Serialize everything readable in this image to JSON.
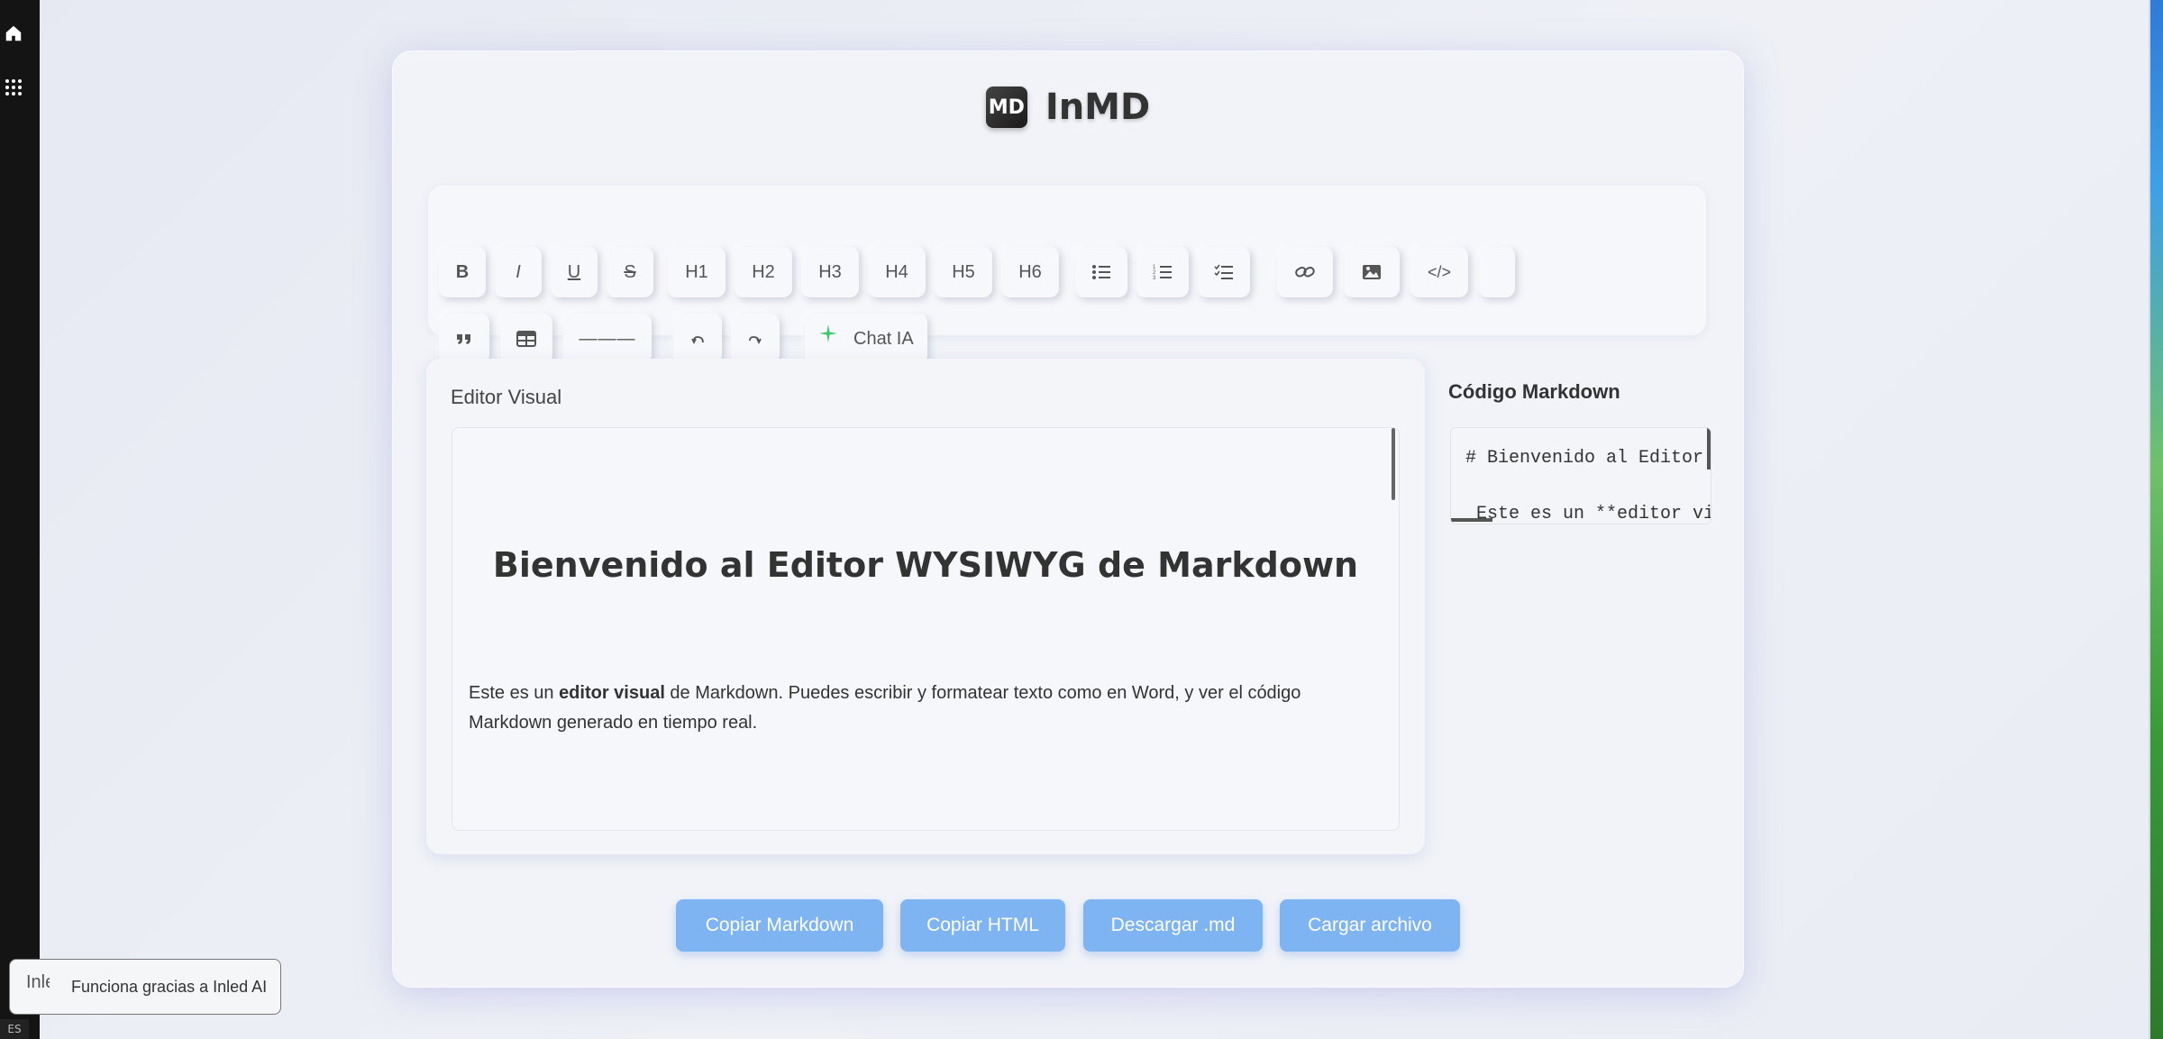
{
  "sidebar": {
    "icons": [
      "home-icon",
      "apps-grid-icon"
    ],
    "language": "ES"
  },
  "brand": {
    "logo_text": "MD",
    "name": "InMD"
  },
  "toolbar": {
    "bold": "B",
    "italic": "I",
    "underline": "U",
    "strike": "S",
    "headings": [
      "H1",
      "H2",
      "H3",
      "H4",
      "H5",
      "H6"
    ],
    "code": "</>",
    "hr": "———",
    "chat": "Chat IA"
  },
  "editor": {
    "label": "Editor Visual",
    "heading": "Bienvenido al Editor WYSIWYG de Markdown",
    "para_prefix": "Este es un ",
    "para_bold": "editor visual",
    "para_suffix": " de Markdown. Puedes escribir y formatear texto como en Word, y ver el código Markdown generado en tiempo real."
  },
  "markdown": {
    "label": "Código Markdown",
    "lines": [
      "# Bienvenido al Editor",
      "Este es un **editor vi"
    ]
  },
  "actions": {
    "copy_md": "Copiar Markdown",
    "copy_html": "Copiar HTML",
    "download": "Descargar .md",
    "load": "Cargar archivo"
  },
  "toast": {
    "ghost": "Inled",
    "text": "Funciona gracias a Inled AI"
  },
  "colors": {
    "accent_button": "#7fb4f2",
    "chat_sparkle": "#3cc76a"
  }
}
